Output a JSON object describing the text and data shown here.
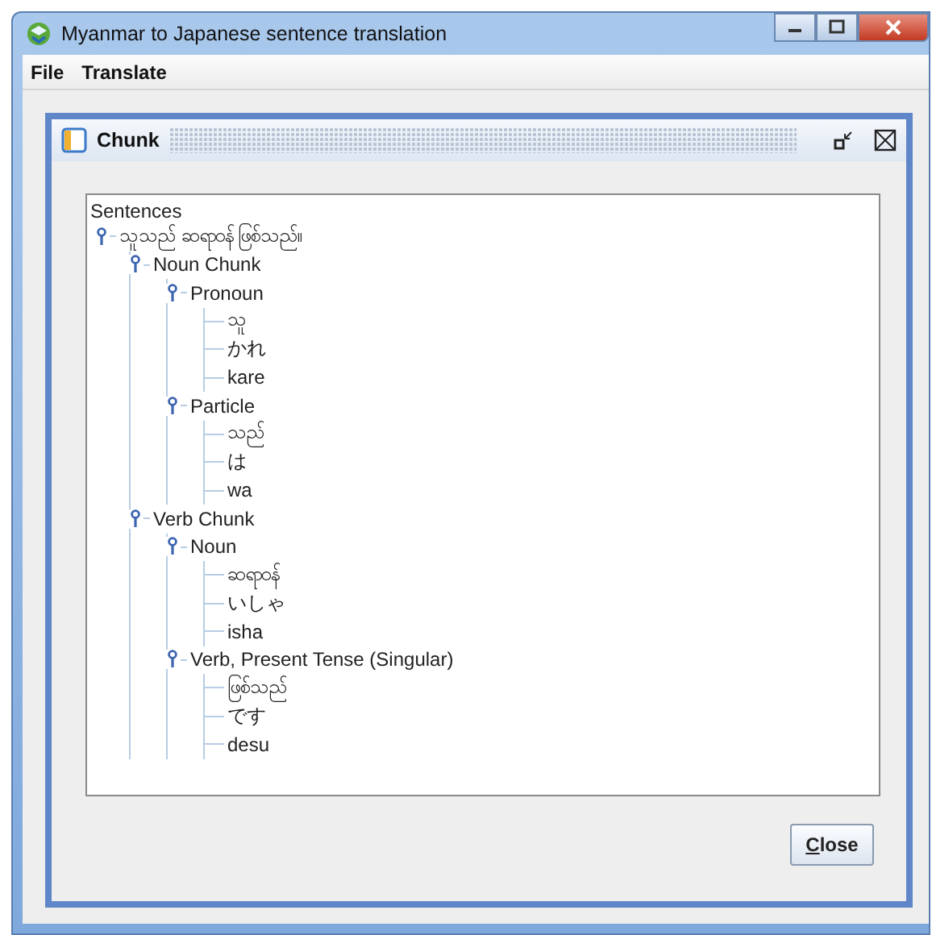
{
  "window": {
    "title": "Myanmar to Japanese sentence translation"
  },
  "menu": [
    {
      "label": "File"
    },
    {
      "label": "Translate"
    }
  ],
  "frame": {
    "title": "Chunk"
  },
  "tree": {
    "label": "Sentences",
    "children": [
      {
        "label": "သူသည် ဆရာဝန် ဖြစ်သည်။",
        "expanded": true,
        "children": [
          {
            "label": "Noun Chunk",
            "expanded": true,
            "children": [
              {
                "label": "Pronoun",
                "expanded": true,
                "children": [
                  {
                    "label": "သူ"
                  },
                  {
                    "label": "かれ"
                  },
                  {
                    "label": "kare"
                  }
                ]
              },
              {
                "label": "Particle",
                "expanded": true,
                "children": [
                  {
                    "label": "သည်"
                  },
                  {
                    "label": "は"
                  },
                  {
                    "label": "wa"
                  }
                ]
              }
            ]
          },
          {
            "label": "Verb Chunk",
            "expanded": true,
            "children": [
              {
                "label": "Noun",
                "expanded": true,
                "children": [
                  {
                    "label": "ဆရာဝန်"
                  },
                  {
                    "label": "いしゃ"
                  },
                  {
                    "label": "isha"
                  }
                ]
              },
              {
                "label": "Verb, Present Tense (Singular)",
                "expanded": true,
                "children": [
                  {
                    "label": "ဖြစ်သည်"
                  },
                  {
                    "label": "です"
                  },
                  {
                    "label": "desu"
                  }
                ]
              }
            ]
          }
        ]
      }
    ]
  },
  "buttons": [
    {
      "label": "Close"
    }
  ]
}
